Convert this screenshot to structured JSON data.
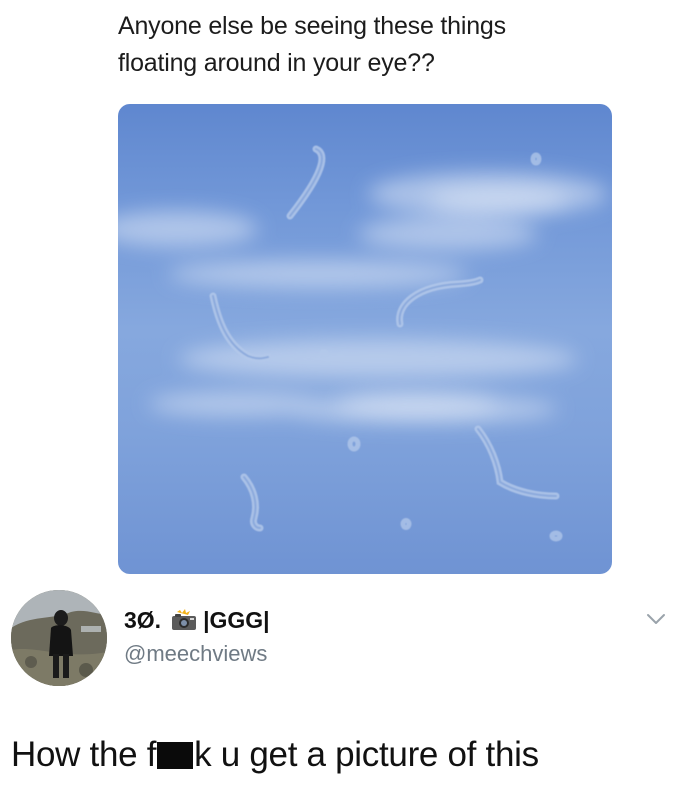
{
  "post": {
    "line1": "Anyone else be seeing these things",
    "line2": "floating around in your eye??"
  },
  "reply": {
    "display_name_prefix": "3Ø.",
    "display_name_suffix": "|GGG|",
    "handle": "@meechviews",
    "text_before": "How the f",
    "text_after": "k u get a picture of this"
  },
  "icons": {
    "name_emoji": "camera-with-flash-icon",
    "more": "chevron-down-icon"
  },
  "colors": {
    "sky": "#7a9ed9",
    "handle_gray": "#6f7a84"
  }
}
